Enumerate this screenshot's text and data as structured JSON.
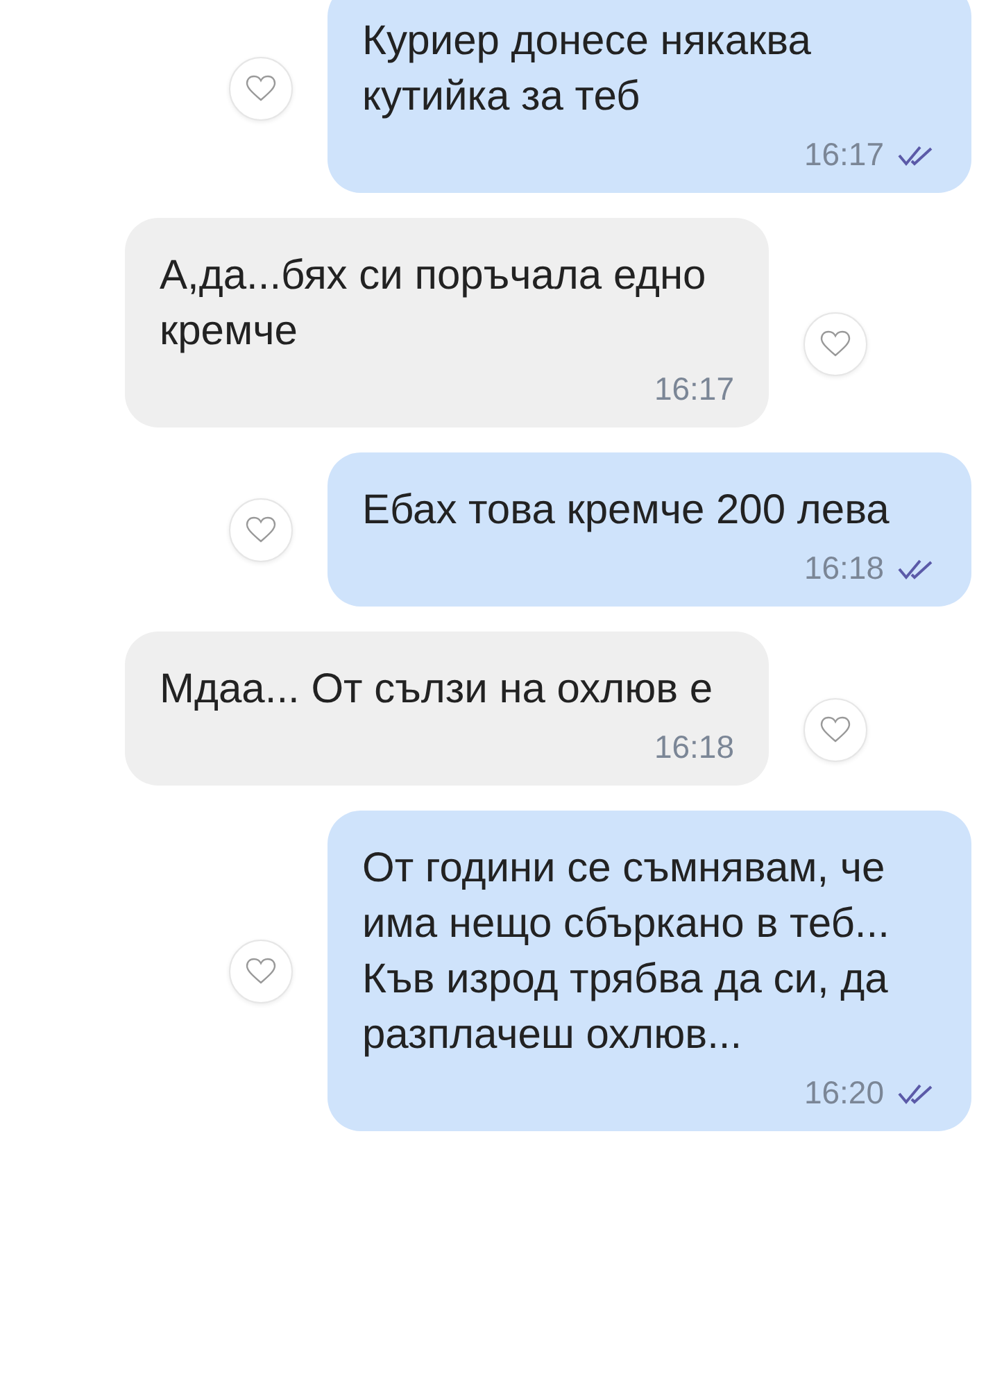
{
  "messages": [
    {
      "kind": "outgoing",
      "text": "Куриер донесе някаква кутийка за теб",
      "time": "16:17",
      "read": true
    },
    {
      "kind": "incoming",
      "text": "А,да...бях си поръчала едно кремче",
      "time": "16:17"
    },
    {
      "kind": "outgoing",
      "text": "Ебах това кремче 200 лева",
      "time": "16:18",
      "read": true
    },
    {
      "kind": "incoming",
      "text": "Мдаа... От сълзи на охлюв е",
      "time": "16:18"
    },
    {
      "kind": "outgoing",
      "text": "От години се съмнявам, че има нещо сбъркано в теб...\nКъв изрод трябва да си, да разплачеш охлюв...",
      "time": "16:20",
      "read": true
    }
  ]
}
